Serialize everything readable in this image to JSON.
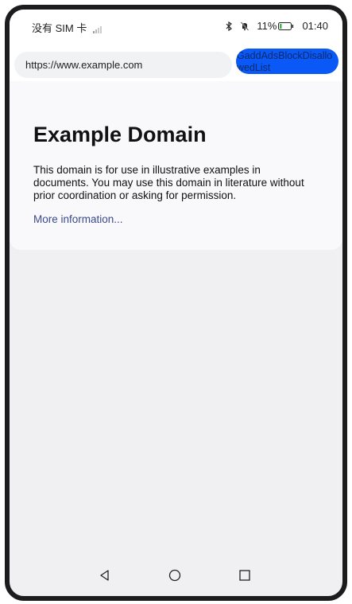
{
  "status_bar": {
    "carrier": "没有 SIM 卡",
    "battery_percent": "11%",
    "time": "01:40"
  },
  "browser": {
    "url": "https://www.example.com",
    "ads_button_label": "GaddAdsBlockDisallowedList"
  },
  "page": {
    "title": "Example Domain",
    "description": "This domain is for use in illustrative examples in documents. You may use this domain in literature without prior coordination or asking for permission.",
    "link_text": "More information..."
  },
  "nav": {
    "icons": [
      "back-triangle-icon",
      "home-circle-icon",
      "recent-square-icon"
    ]
  },
  "colors": {
    "accent": "#0a59f7",
    "link": "#3b4a8a",
    "battery_low": "#4caf50"
  }
}
